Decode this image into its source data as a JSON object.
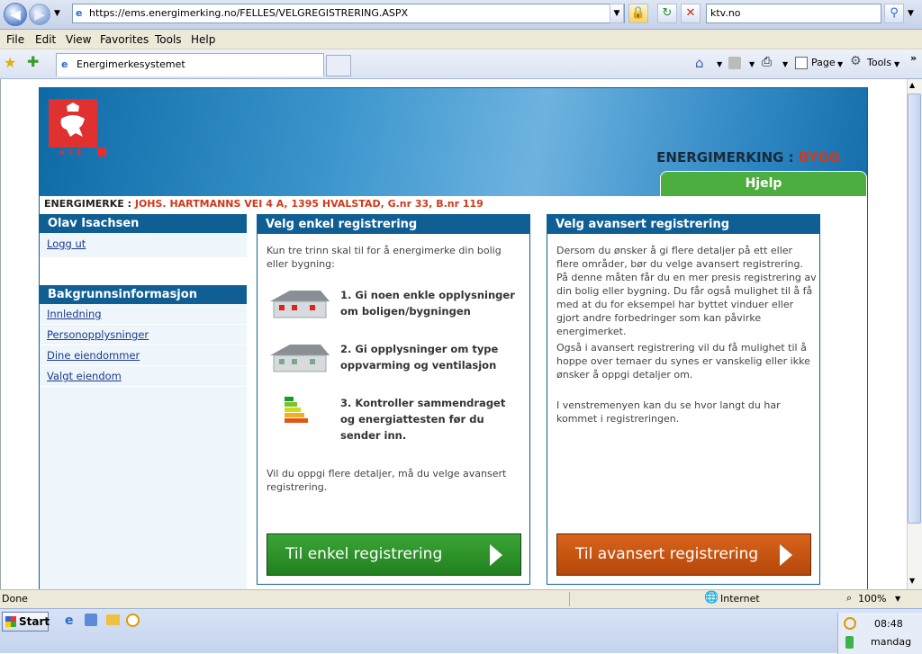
{
  "browser": {
    "url": "https://ems.energimerking.no/FELLES/VELGREGISTRERING.ASPX",
    "search_value": "ktv.no",
    "menu": [
      "File",
      "Edit",
      "View",
      "Favorites",
      "Tools",
      "Help"
    ],
    "tab_title": "Energimerkesystemet",
    "cmd_page": "Page",
    "cmd_tools": "Tools"
  },
  "site": {
    "logo_text": "NVE",
    "brand_prefix": "ENERGIMERKING : ",
    "brand_suffix": "BYGG",
    "help_tab": "Hjelp",
    "em_label": "ENERGIMERKE : ",
    "em_address": "JOHS. HARTMANNS VEI 4 A, 1395 HVALSTAD, G.nr 33, B.nr 119"
  },
  "leftnav": {
    "user_name": "Olav Isachsen",
    "logout": "Logg ut",
    "section_title": "Bakgrunnsinformasjon",
    "items": [
      "Innledning",
      "Personopplysninger",
      "Dine eiendommer",
      "Valgt eiendom"
    ]
  },
  "simple": {
    "title": "Velg enkel registrering",
    "intro": "Kun tre trinn skal til for å energimerke din bolig eller bygning:",
    "step1": "1. Gi noen enkle opplysninger om boligen/bygningen",
    "step2": "2. Gi opplysninger om type oppvarming og ventilasjon",
    "step3": "3. Kontroller sammendraget og energiattesten før du sender inn.",
    "outro": "Vil du oppgi flere detaljer, må du velge avansert registrering.",
    "button": "Til enkel registrering",
    "button_color": "#2e8b2a"
  },
  "advanced": {
    "title": "Velg avansert registrering",
    "p1": "Dersom du ønsker å gi flere detaljer på ett eller flere områder, bør du velge avansert registrering. På denne måten får du en mer presis registrering av din bolig eller bygning. Du får også mulighet til å få med at du for eksempel har byttet vinduer eller gjort andre forbedringer som kan påvirke energimerket.",
    "p2": "Også i avansert registrering vil du få mulighet til å hoppe over temaer du synes er vanskelig eller ikke ønsker å oppgi detaljer om.",
    "p3": "I venstremenyen kan du se hvor langt du har kommet i registreringen.",
    "button": "Til avansert registrering",
    "button_color": "#c8530f"
  },
  "status": {
    "left": "Done",
    "zone": "Internet",
    "zoom": "100%"
  },
  "taskbar": {
    "start": "Start",
    "clock": "08:48",
    "day": "mandag"
  }
}
